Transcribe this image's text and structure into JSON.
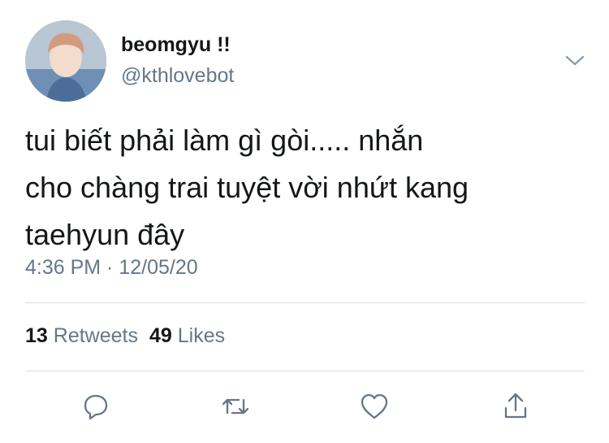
{
  "user": {
    "display_name": "beomgyu !!",
    "handle": "@kthlovebot"
  },
  "tweet": {
    "lines": [
      "tui biết phải làm gì gòi..... nhắn",
      "cho chàng trai tuyệt vời nhứt kang",
      "taehyun đây"
    ],
    "timestamp": "4:36 PM · 12/05/20"
  },
  "stats": {
    "retweets_count": "13",
    "retweets_label": "Retweets",
    "likes_count": "49",
    "likes_label": "Likes"
  },
  "icons": {
    "menu": "chevron-down-icon",
    "reply": "reply-icon",
    "retweet": "retweet-icon",
    "like": "heart-icon",
    "share": "share-icon"
  },
  "colors": {
    "text_primary": "#14171a",
    "text_secondary": "#657786",
    "icon": "#657786",
    "divider": "#d9dde1"
  }
}
